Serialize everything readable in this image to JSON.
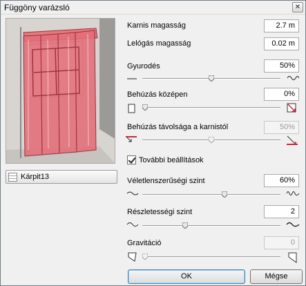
{
  "window": {
    "title": "Függöny varázsló",
    "close_glyph": "✕"
  },
  "material_button": {
    "label": "Kárpit13"
  },
  "fields": {
    "rod_height": {
      "label": "Karnis magasság",
      "value": "2.7 m"
    },
    "overhang_height": {
      "label": "Lelógás magasság",
      "value": "0.02 m"
    },
    "gathering": {
      "label": "Gyurodés",
      "value": "50%",
      "slider_fraction": 0.5
    },
    "draw_center": {
      "label": "Behúzás középen",
      "value": "0%",
      "slider_fraction": 0.0
    },
    "draw_distance": {
      "label": "Behúzás távolsága a karnistól",
      "value": "50%",
      "slider_fraction": 0.5,
      "disabled": true
    },
    "randomness": {
      "label": "Véletlenszerűségi szint",
      "value": "60%",
      "slider_fraction": 0.6
    },
    "detail_level": {
      "label": "Részletességi szint",
      "value": "2",
      "slider_fraction": 0.3
    },
    "gravity": {
      "label": "Gravitáció",
      "value": "0",
      "slider_fraction": 0.0,
      "disabled": true
    }
  },
  "more_settings": {
    "label": "További beállítások",
    "checked": true
  },
  "buttons": {
    "ok": "OK",
    "cancel": "Mégse"
  },
  "colors": {
    "curtain": "#e0707a",
    "curtain_edge": "#b23a48",
    "accent_red": "#c8283a",
    "window_bg": "#f0f0f0"
  }
}
